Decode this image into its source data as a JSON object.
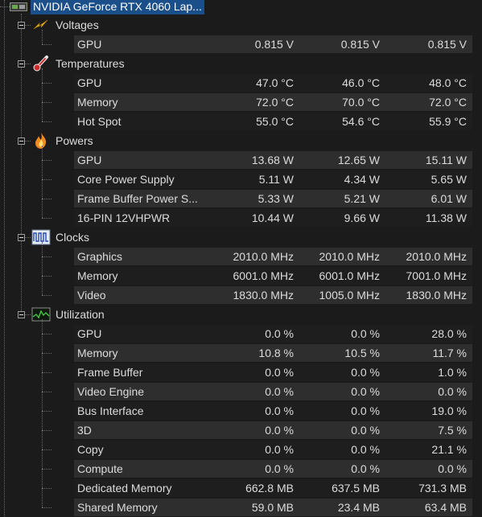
{
  "root": {
    "title": "NVIDIA GeForce RTX 4060 Lap..."
  },
  "icons": {
    "gpu": "gpu-card-icon",
    "voltages": "lightning-icon",
    "temperatures": "thermometer-icon",
    "powers": "flame-icon",
    "clocks": "clock-pulse-icon",
    "utilization": "activity-monitor-icon"
  },
  "categories": [
    {
      "key": "voltages",
      "label": "Voltages",
      "rows": [
        {
          "name": "GPU",
          "v1": "0.815 V",
          "v2": "0.815 V",
          "v3": "0.815 V"
        }
      ]
    },
    {
      "key": "temperatures",
      "label": "Temperatures",
      "rows": [
        {
          "name": "GPU",
          "v1": "47.0 °C",
          "v2": "46.0 °C",
          "v3": "48.0 °C"
        },
        {
          "name": "Memory",
          "v1": "72.0 °C",
          "v2": "70.0 °C",
          "v3": "72.0 °C"
        },
        {
          "name": "Hot Spot",
          "v1": "55.0 °C",
          "v2": "54.6 °C",
          "v3": "55.9 °C"
        }
      ]
    },
    {
      "key": "powers",
      "label": "Powers",
      "rows": [
        {
          "name": "GPU",
          "v1": "13.68 W",
          "v2": "12.65 W",
          "v3": "15.11 W"
        },
        {
          "name": "Core Power Supply",
          "v1": "5.11 W",
          "v2": "4.34 W",
          "v3": "5.65 W"
        },
        {
          "name": "Frame Buffer Power S...",
          "v1": "5.33 W",
          "v2": "5.21 W",
          "v3": "6.01 W"
        },
        {
          "name": "16-PIN 12VHPWR",
          "v1": "10.44 W",
          "v2": "9.66 W",
          "v3": "11.38 W"
        }
      ]
    },
    {
      "key": "clocks",
      "label": "Clocks",
      "rows": [
        {
          "name": "Graphics",
          "v1": "2010.0 MHz",
          "v2": "2010.0 MHz",
          "v3": "2010.0 MHz"
        },
        {
          "name": "Memory",
          "v1": "6001.0 MHz",
          "v2": "6001.0 MHz",
          "v3": "7001.0 MHz"
        },
        {
          "name": "Video",
          "v1": "1830.0 MHz",
          "v2": "1005.0 MHz",
          "v3": "1830.0 MHz"
        }
      ]
    },
    {
      "key": "utilization",
      "label": "Utilization",
      "rows": [
        {
          "name": "GPU",
          "v1": "0.0 %",
          "v2": "0.0 %",
          "v3": "28.0 %"
        },
        {
          "name": "Memory",
          "v1": "10.8 %",
          "v2": "10.5 %",
          "v3": "11.7 %"
        },
        {
          "name": "Frame Buffer",
          "v1": "0.0 %",
          "v2": "0.0 %",
          "v3": "1.0 %"
        },
        {
          "name": "Video Engine",
          "v1": "0.0 %",
          "v2": "0.0 %",
          "v3": "0.0 %"
        },
        {
          "name": "Bus Interface",
          "v1": "0.0 %",
          "v2": "0.0 %",
          "v3": "19.0 %"
        },
        {
          "name": "3D",
          "v1": "0.0 %",
          "v2": "0.0 %",
          "v3": "7.5 %"
        },
        {
          "name": "Copy",
          "v1": "0.0 %",
          "v2": "0.0 %",
          "v3": "21.1 %"
        },
        {
          "name": "Compute",
          "v1": "0.0 %",
          "v2": "0.0 %",
          "v3": "0.0 %"
        },
        {
          "name": "Dedicated Memory",
          "v1": "662.8 MB",
          "v2": "637.5 MB",
          "v3": "731.3 MB"
        },
        {
          "name": "Shared Memory",
          "v1": "59.0 MB",
          "v2": "23.4 MB",
          "v3": "63.4 MB"
        }
      ]
    }
  ]
}
